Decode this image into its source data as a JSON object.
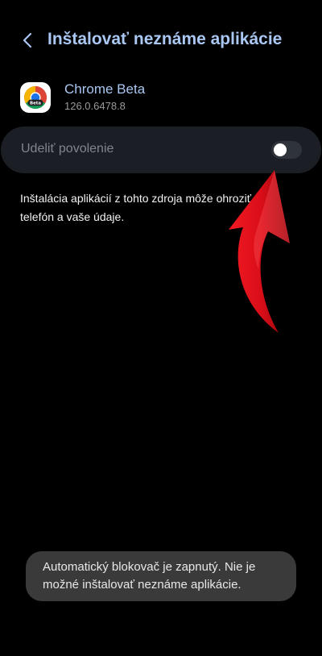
{
  "header": {
    "title": "Inštalovať neznáme aplikácie"
  },
  "app": {
    "name": "Chrome Beta",
    "version": "126.0.6478.8",
    "icon_badge": "Beta"
  },
  "permission": {
    "label": "Udeliť povolenie",
    "enabled": false
  },
  "description": {
    "text": "Inštalácia aplikácií z tohto zdroja môže ohroziť váš telefón a vaše údaje."
  },
  "toast": {
    "message": "Automatický blokovač je zapnutý. Nie je možné inštalovať neznáme aplikácie."
  },
  "colors": {
    "accent": "#a9c7f2",
    "card": "#1b1f25",
    "toast": "#3a3a3a",
    "arrow": "#e3101a"
  },
  "icons": {
    "back": "chevron-left-icon",
    "app": "chrome-beta-icon"
  }
}
